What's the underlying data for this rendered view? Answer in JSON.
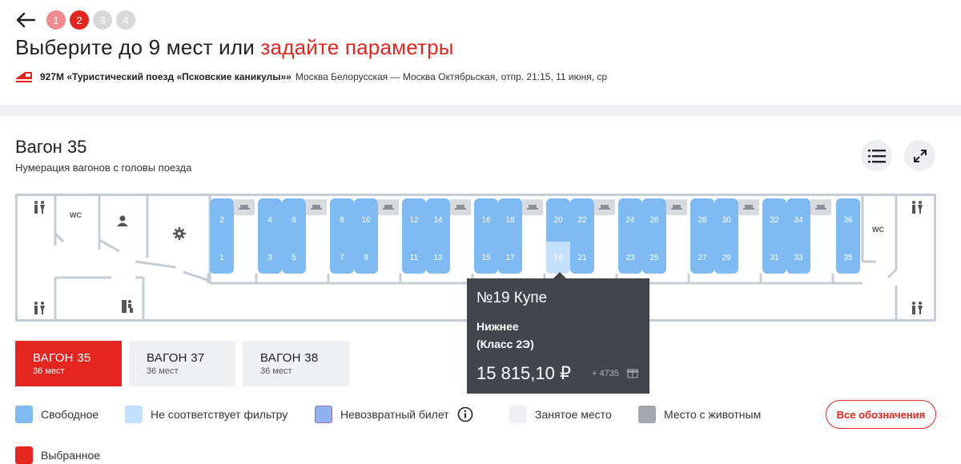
{
  "header": {
    "steps": [
      "1",
      "2",
      "3",
      "4"
    ],
    "title_prefix": "Выберите до 9 мест или ",
    "title_link": "задайте параметры",
    "train_name": "927М «Туристический поезд «Псковские каникулы»»",
    "route": "Москва Белорусская — Москва Октябрьская,",
    "departure": "отпр. 21:15, 11 июня, ср"
  },
  "car": {
    "title": "Вагон 35",
    "subtitle": "Нумерация вагонов с головы поезда",
    "wc_label": "WC",
    "upper_seats": [
      "2",
      "4",
      "6",
      "8",
      "10",
      "12",
      "14",
      "16",
      "18",
      "20",
      "22",
      "24",
      "26",
      "28",
      "30",
      "32",
      "34",
      "36"
    ],
    "lower_seats": [
      "1",
      "3",
      "5",
      "7",
      "9",
      "11",
      "13",
      "15",
      "17",
      "19",
      "21",
      "23",
      "25",
      "27",
      "29",
      "31",
      "33",
      "35"
    ],
    "dimmed_seat": "19"
  },
  "tooltip": {
    "heading": "№19 Купе",
    "tier": "Нижнее",
    "class": "(Класс 2Э)",
    "price": "15 815,10 ₽",
    "bonus": "+ 4735"
  },
  "wagons": [
    {
      "label": "ВАГОН 35",
      "seats": "36 мест"
    },
    {
      "label": "ВАГОН 37",
      "seats": "36 мест"
    },
    {
      "label": "ВАГОН 38",
      "seats": "36 мест"
    }
  ],
  "legend": {
    "free": "Свободное",
    "no_filter": "Не соответствует фильтру",
    "nonrefund": "Невозвратный билет",
    "occupied": "Занятое место",
    "pets": "Место с животным",
    "selected": "Выбранное",
    "all_button": "Все обозначения"
  },
  "colors": {
    "accent": "#e42520",
    "seat_free": "#7fbaf3",
    "seat_dim": "#c5e0fb",
    "nonrefund": "#8fb1ef",
    "occupied": "#eef0f3",
    "pets": "#a3a7b0"
  }
}
